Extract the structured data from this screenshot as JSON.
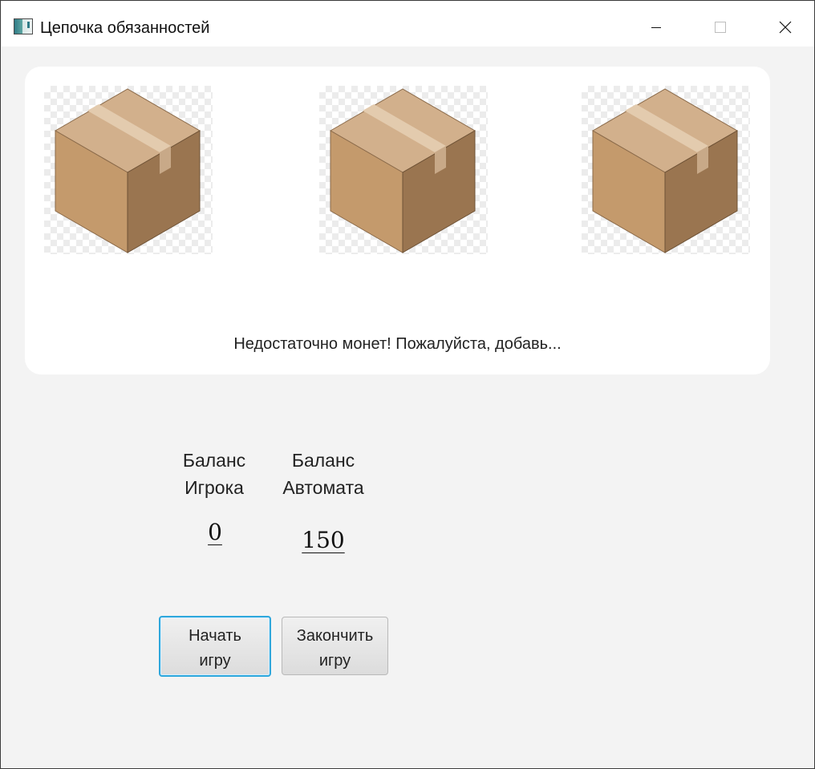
{
  "window": {
    "title": "Цепочка обязанностей",
    "controls": {
      "minimize": "minimize-icon",
      "maximize": "maximize-icon",
      "close": "close-icon"
    }
  },
  "slots": {
    "images": [
      "cardboard-box",
      "cardboard-box",
      "cardboard-box"
    ],
    "message": "Недостаточно монет! Пожалуйста, добавь..."
  },
  "balances": {
    "player": {
      "label_line1": "Баланс",
      "label_line2": "Игрока",
      "value": "0"
    },
    "machine": {
      "label_line1": "Баланс",
      "label_line2": "Автомата",
      "value": "150"
    }
  },
  "buttons": {
    "start": {
      "line1": "Начать",
      "line2": "игру"
    },
    "end": {
      "line1": "Закончить",
      "line2": "игру"
    }
  },
  "colors": {
    "focus_border": "#2ea7dc",
    "background": "#f3f3f3",
    "panel": "#ffffff"
  }
}
